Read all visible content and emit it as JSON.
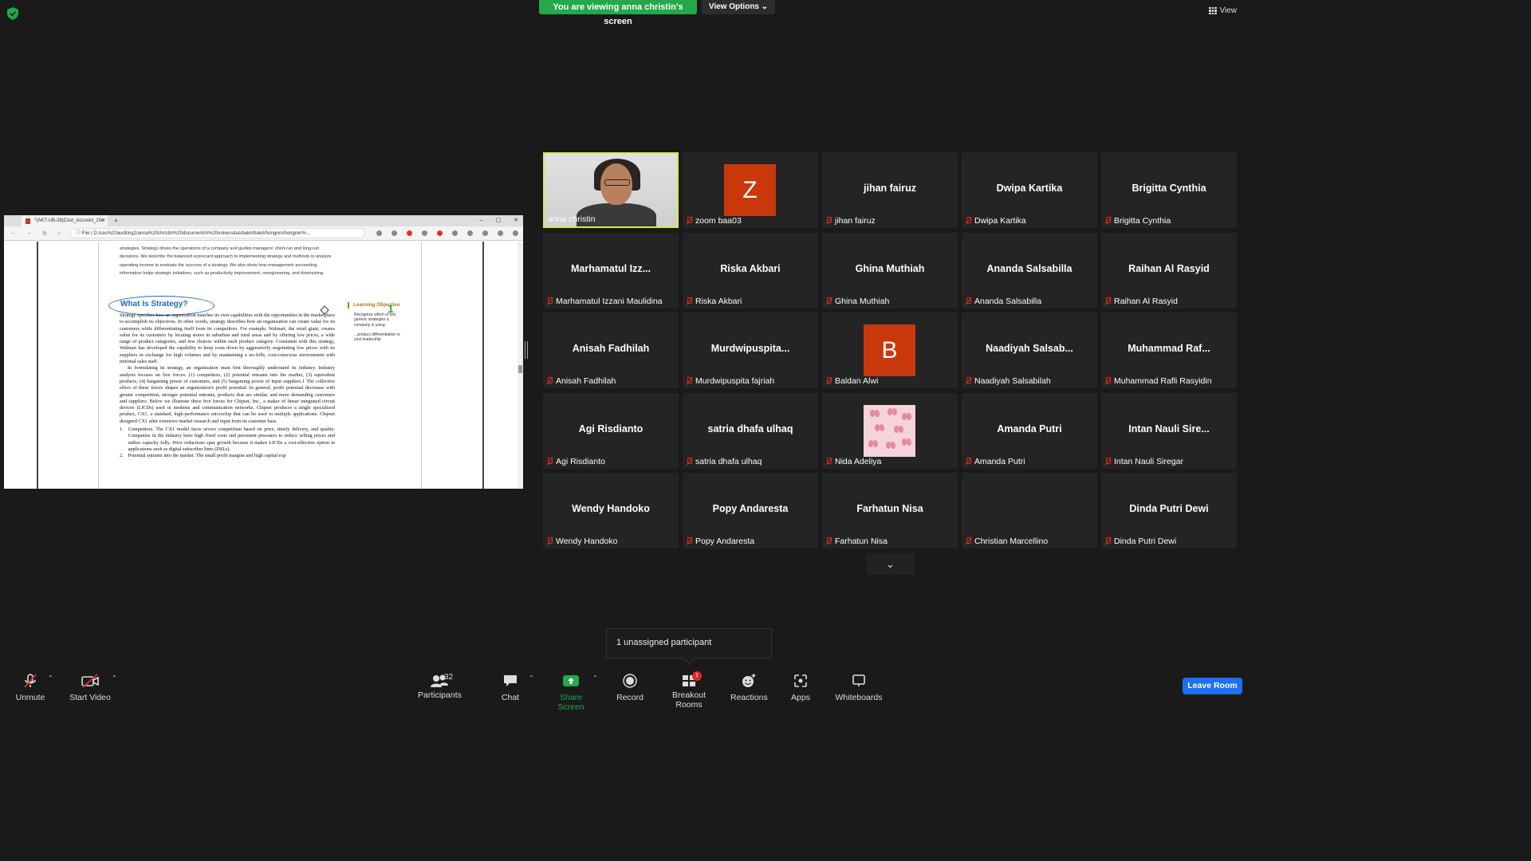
{
  "banner": {
    "viewing": "You are viewing anna christin's screen",
    "view_options": "View Options"
  },
  "view_button": "View",
  "browser": {
    "tab_title": "*(AKT-UB-28)Cost_Account_15e",
    "tab_close": "×",
    "new_tab": "+",
    "win_min": "–",
    "win_max": "▢",
    "win_close": "✕",
    "file_label": "File",
    "address": "D:/uas%20auditing2/anna%20christin%20document/A%20universitas/bakri/bakri/hongren/hongren%..."
  },
  "pdf": {
    "intro": "strategies. Strategy drives the operations of a company and guides managers' short-run and long-run decisions. We describe the balanced scorecard approach to implementing strategy and methods to analyze operating income to evaluate the success of a strategy. We also show how management accounting information helps strategic initiatives, such as productivity improvement, reengineering, and downsizing.",
    "heading": "What Is Strategy?",
    "para1": "Strategy specifies how an organization matches its own capabilities with the opportunities in the marketplace to accomplish its objectives. In other words, strategy describes how an organization can create value for its customers while differentiating itself from its competitors. For example, Walmart, the retail giant, creates value for its customers by locating stores in suburban and rural areas and by offering low prices, a wide range of product categories, and few choices within each product category. Consistent with this strategy, Walmart has developed the capability to keep costs down by aggressively negotiating low prices with its suppliers in exchange for high volumes and by maintaining a no-frills, cost-conscious environment with minimal sales staff.",
    "para2": "In formulating its strategy, an organization must first thoroughly understand its industry. Industry analysis focuses on five forces: (1) competitors, (2) potential entrants into the market, (3) equivalent products, (4) bargaining power of customers, and (5) bargaining power of input suppliers.1 The collective effect of these forces shapes an organization's profit potential. In general, profit potential decreases with greater competition, stronger potential entrants, products that are similar, and more demanding customers and suppliers. Below we illustrate these five forces for Chipset, Inc., a maker of linear integrated circuit devices (LICDs) used in modems and communication networks. Chipset produces a single specialized product, CX1, a standard, high-performance microchip that can be used in multiple applications. Chipset designed CX1 after extensive market research and input from its customer base.",
    "list1_num": "1.",
    "list1": "Competitors. The CX1 model faces severe competition based on price, timely delivery, and quality. Companies in the industry have high fixed costs and persistent pressures to reduce selling prices and utilize capacity fully. Price reductions spur growth because it makes LICDs a cost-effective option in applications such as digital subscriber lines (DSLs).",
    "list2_num": "2.",
    "list2": "Potential entrants into the market. The small profit margins and high capital exp",
    "lo_title": "Learning Objective",
    "lo_num": "1",
    "lo_text": "Recognize which of two generic strategies a company is using",
    "lo_text2": "...product differentiation or cost leadership"
  },
  "participants_tiles": [
    {
      "big": "",
      "name": "anna christin",
      "active": true,
      "type": "video"
    },
    {
      "big": "",
      "name": "zoom baa03",
      "avatar": "Z",
      "avatar_color": "#c9380a"
    },
    {
      "big": "jihan fairuz",
      "name": "jihan fairuz"
    },
    {
      "big": "Dwipa Kartika",
      "name": "Dwipa Kartika"
    },
    {
      "big": "Brigitta Cynthia",
      "name": "Brigitta Cynthia"
    },
    {
      "big": "Marhamatul  Izz...",
      "name": "Marhamatul Izzani Maulidina"
    },
    {
      "big": "Riska Akbari",
      "name": "Riska Akbari"
    },
    {
      "big": "Ghina Muthiah",
      "name": "Ghina Muthiah"
    },
    {
      "big": "Ananda Salsabilla",
      "name": "Ananda Salsabilla"
    },
    {
      "big": "Raihan Al Rasyid",
      "name": "Raihan Al Rasyid"
    },
    {
      "big": "Anisah Fadhilah",
      "name": "Anisah Fadhilah"
    },
    {
      "big": "Murdwipuspita...",
      "name": "Murdwipuspita fajriah"
    },
    {
      "big": "",
      "name": "Baldan Alwi",
      "avatar": "B",
      "avatar_color": "#c9380a"
    },
    {
      "big": "Naadiyah  Salsab...",
      "name": "Naadiyah Salsabilah"
    },
    {
      "big": "Muhammad  Raf...",
      "name": "Muhammad Rafli Rasyidin"
    },
    {
      "big": "Agi Risdianto",
      "name": "Agi Risdianto"
    },
    {
      "big": "satria dhafa ulhaq",
      "name": "satria dhafa ulhaq"
    },
    {
      "big": "",
      "name": "Nida Adeliya",
      "type": "butterfly"
    },
    {
      "big": "Amanda Putri",
      "name": "Amanda Putri"
    },
    {
      "big": "Intan  Nauli  Sire...",
      "name": "Intan Nauli Siregar"
    },
    {
      "big": "Wendy Handoko",
      "name": "Wendy Handoko"
    },
    {
      "big": "Popy Andaresta",
      "name": "Popy Andaresta"
    },
    {
      "big": "Farhatun Nisa",
      "name": "Farhatun Nisa"
    },
    {
      "big": "",
      "name": "Christian Marcellino"
    },
    {
      "big": "Dinda Putri Dewi",
      "name": "Dinda Putri Dewi"
    }
  ],
  "unassigned": "1 unassigned participant",
  "toolbar": {
    "unmute": "Unmute",
    "start_video": "Start Video",
    "participants": "Participants",
    "participants_count": "32",
    "chat": "Chat",
    "share_screen": "Share Screen",
    "record": "Record",
    "breakout_rooms": "Breakout Rooms",
    "breakout_badge": "1",
    "reactions": "Reactions",
    "apps": "Apps",
    "whiteboards": "Whiteboards",
    "leave_room": "Leave Room"
  },
  "colors": {
    "share_green": "#23a84a",
    "leave_blue": "#1f6ff2",
    "muted_red": "#e02828",
    "active_border": "#d7e94a"
  }
}
